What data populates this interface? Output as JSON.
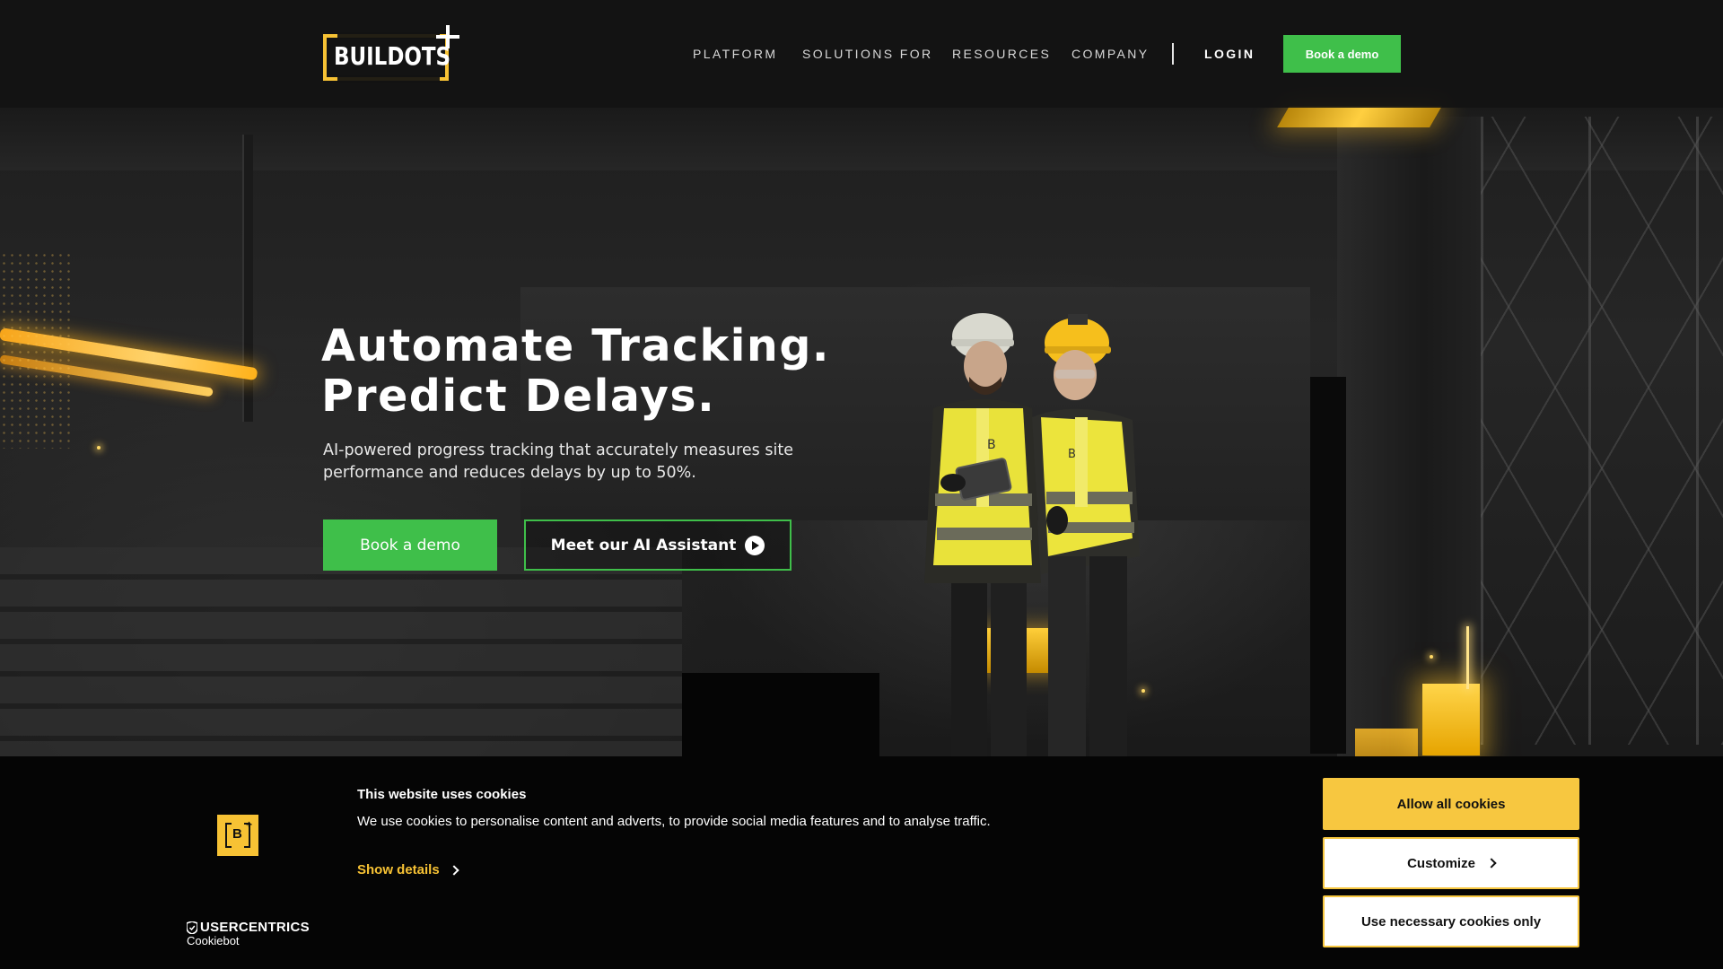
{
  "brand": {
    "logo_text": "BUILDOTS"
  },
  "nav": {
    "items": [
      {
        "label": "PLATFORM"
      },
      {
        "label": "SOLUTIONS FOR"
      },
      {
        "label": "RESOURCES"
      },
      {
        "label": "COMPANY"
      }
    ],
    "login_label": "LOGIN",
    "demo_label": "Book a demo"
  },
  "hero": {
    "title_line1": "Automate Tracking.",
    "title_line2": "Predict Delays.",
    "subtitle": "AI-powered progress tracking that accurately measures site performance and reduces delays by up to 50%.",
    "primary_cta": "Book a demo",
    "secondary_cta": "Meet our AI Assistant",
    "secondary_cta_icon": "play-icon"
  },
  "cookie_banner": {
    "title": "This website uses cookies",
    "text": "We use cookies to personalise content and adverts, to provide social media features and to analyse traffic.",
    "show_details": "Show details",
    "allow_all": "Allow all cookies",
    "customize": "Customize",
    "necessary_only": "Use necessary cookies only",
    "provider_name": "USERCENTRICS",
    "provider_sub": "Cookiebot"
  },
  "colors": {
    "accent_green": "#3fbf4a",
    "brand_yellow": "#f7c234",
    "cookie_button_yellow": "#f7c740",
    "header_bg": "#121212"
  }
}
